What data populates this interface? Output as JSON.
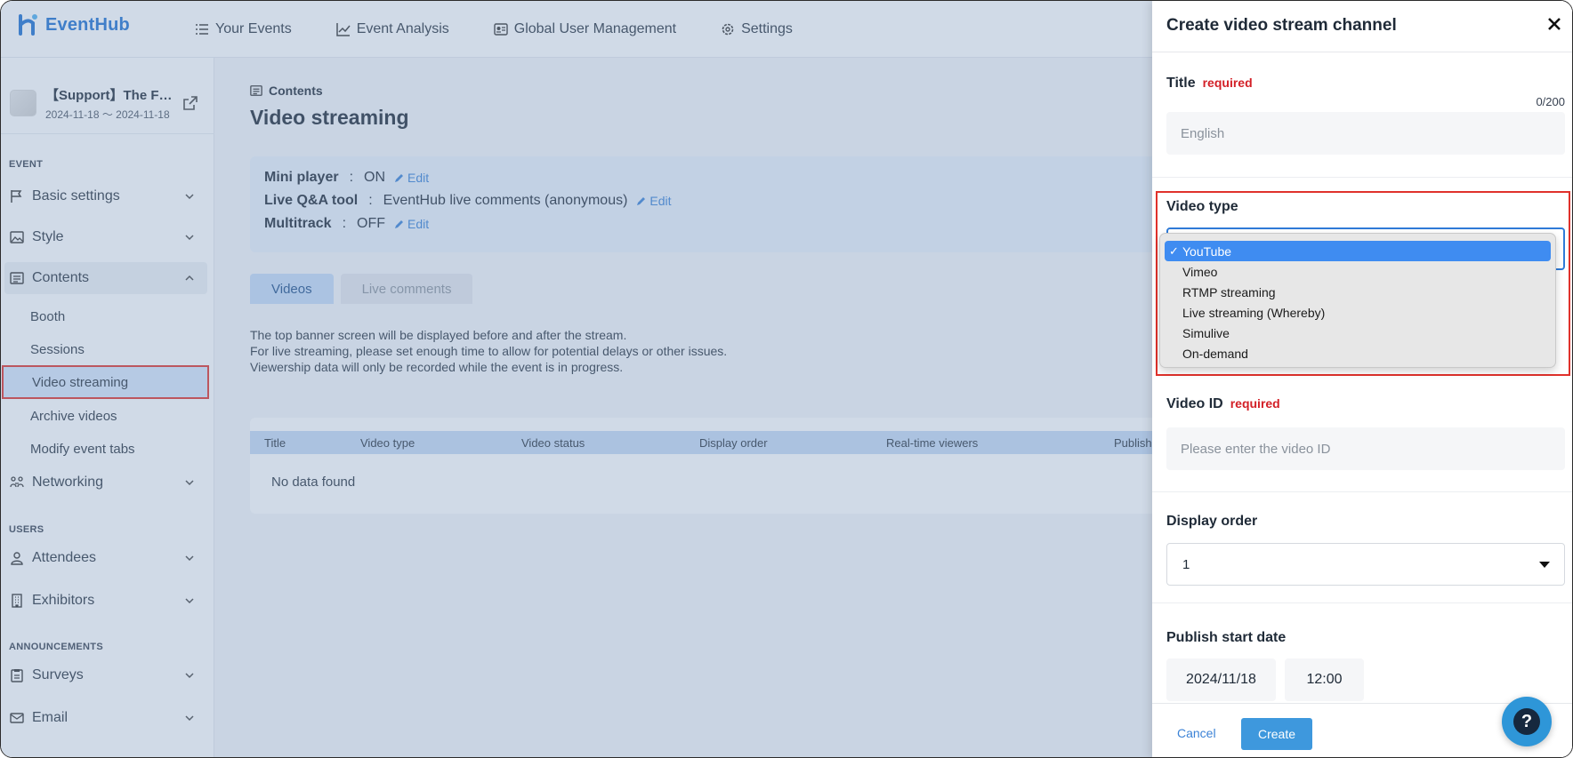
{
  "brand": {
    "name": "EventHub"
  },
  "nav": [
    {
      "label": "Your Events",
      "icon": "list-icon"
    },
    {
      "label": "Event Analysis",
      "icon": "chart-icon"
    },
    {
      "label": "Global User Management",
      "icon": "id-card-icon"
    },
    {
      "label": "Settings",
      "icon": "gear-icon"
    }
  ],
  "event": {
    "name": "【Support】The F…",
    "dates": "2024-11-18 〜 2024-11-18"
  },
  "sidebar": {
    "section_event": "EVENT",
    "basic_settings": "Basic settings",
    "style": "Style",
    "contents": "Contents",
    "contents_sub": [
      "Booth",
      "Sessions",
      "Video streaming",
      "Archive videos",
      "Modify event tabs"
    ],
    "networking": "Networking",
    "section_users": "USERS",
    "attendees": "Attendees",
    "exhibitors": "Exhibitors",
    "section_announcements": "ANNOUNCEMENTS",
    "surveys": "Surveys",
    "email": "Email"
  },
  "main": {
    "breadcrumb": "Contents",
    "title": "Video streaming",
    "settings": [
      {
        "key": "Mini player",
        "value": "ON",
        "edit": "Edit"
      },
      {
        "key": "Live Q&A tool",
        "value": "EventHub live comments (anonymous)",
        "edit": "Edit"
      },
      {
        "key": "Multitrack",
        "value": "OFF",
        "edit": "Edit"
      }
    ],
    "tabs": [
      "Videos",
      "Live comments"
    ],
    "notice": [
      "The top banner screen will be displayed before and after the stream.",
      "For live streaming, please set enough time to allow for potential delays or other issues.",
      "Viewership data will only be recorded while the event is in progress."
    ],
    "table_headers": [
      "Title",
      "Video type",
      "Video status",
      "Display order",
      "Real-time viewers",
      "Publish"
    ],
    "no_data": "No data found"
  },
  "drawer": {
    "title": "Create video stream channel",
    "title_label": "Title",
    "required": "required",
    "counter": "0/200",
    "title_placeholder": "English",
    "video_type_label": "Video type",
    "video_type_options": [
      "YouTube",
      "Vimeo",
      "RTMP streaming",
      "Live streaming (Whereby)",
      "Simulive",
      "On-demand"
    ],
    "video_type_check": "✓",
    "video_id_label": "Video ID",
    "video_id_placeholder": "Please enter the video ID",
    "display_order_label": "Display order",
    "display_order_value": "1",
    "publish_start_label": "Publish start date",
    "publish_date": "2024/11/18",
    "publish_time": "12:00",
    "cancel": "Cancel",
    "create": "Create"
  },
  "help": {
    "label": "?"
  },
  "colors": {
    "accent": "#2f7bd8",
    "required": "#d32027",
    "highlight": "#e0312b",
    "brand": "#1d6fd1"
  }
}
